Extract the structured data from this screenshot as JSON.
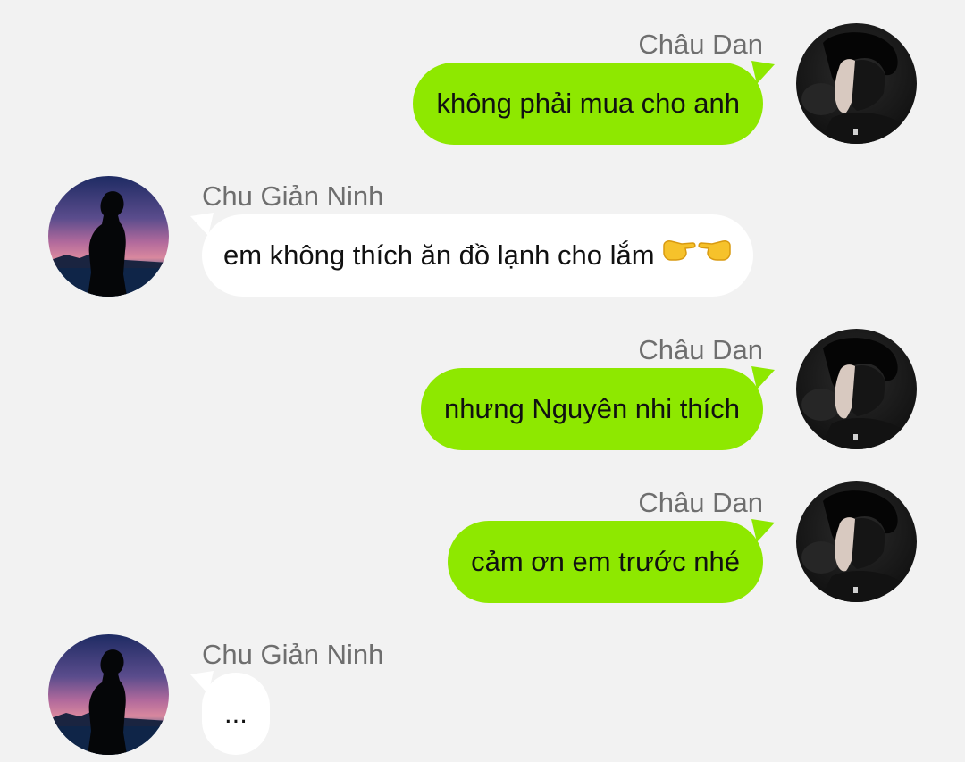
{
  "messages": [
    {
      "direction": "outgoing",
      "sender": "Châu Dan",
      "text": "không phải mua cho anh"
    },
    {
      "direction": "incoming",
      "sender": "Chu Giản Ninh",
      "text": "em không thích ăn đồ lạnh cho lắm",
      "emoji": "point-right-left-hands"
    },
    {
      "direction": "outgoing",
      "sender": "Châu Dan",
      "text": "nhưng Nguyên nhi thích"
    },
    {
      "direction": "outgoing",
      "sender": "Châu Dan",
      "text": "cảm ơn em trước nhé"
    },
    {
      "direction": "incoming",
      "sender": "Chu Giản Ninh",
      "text": "..."
    }
  ],
  "colors": {
    "background": "#f2f2f2",
    "outgoing_bubble": "#8ee800",
    "incoming_bubble": "#ffffff",
    "sender_name": "#6e6e6e",
    "message_text": "#111111"
  }
}
